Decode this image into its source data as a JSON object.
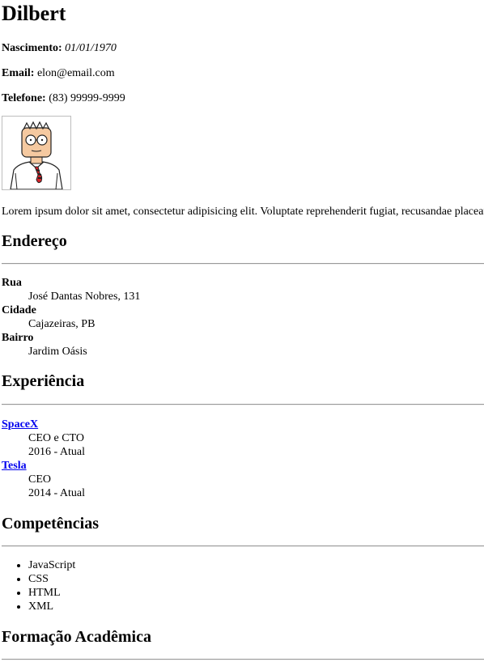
{
  "profile": {
    "name": "Dilbert",
    "birth_label": "Nascimento:",
    "birth_value": "01/01/1970",
    "email_label": "Email:",
    "email_value": "elon@email.com",
    "phone_label": "Telefone:",
    "phone_value": "(83) 99999-9999",
    "bio": "Lorem ipsum dolor sit amet, consectetur adipisicing elit. Voluptate reprehenderit fugiat, recusandae placeat"
  },
  "address": {
    "heading": "Endereço",
    "items": [
      {
        "label": "Rua",
        "value": "José Dantas Nobres, 131"
      },
      {
        "label": "Cidade",
        "value": "Cajazeiras, PB"
      },
      {
        "label": "Bairro",
        "value": "Jardim Oásis"
      }
    ]
  },
  "experience": {
    "heading": "Experiência",
    "items": [
      {
        "company": "SpaceX",
        "role": "CEO e CTO",
        "period": "2016 - Atual"
      },
      {
        "company": "Tesla",
        "role": "CEO",
        "period": "2014 - Atual"
      }
    ]
  },
  "skills": {
    "heading": "Competências",
    "items": [
      "JavaScript",
      "CSS",
      "HTML",
      "XML"
    ]
  },
  "education": {
    "heading": "Formação Acadêmica"
  },
  "colors": {
    "link": "#0000ee",
    "rule": "#9a9a9a"
  }
}
